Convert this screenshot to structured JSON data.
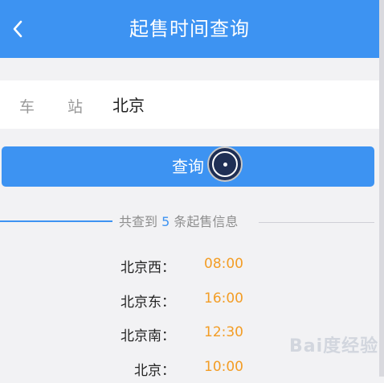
{
  "header": {
    "title": "起售时间查询",
    "back_icon": "chevron-left-icon",
    "color": "#3d93f2"
  },
  "form": {
    "station_label_chars": [
      "车",
      "站"
    ],
    "station_value": "北京"
  },
  "query_button": {
    "label": "查询"
  },
  "summary": {
    "prefix": "共查到",
    "count": "5",
    "suffix": "条起售信息"
  },
  "results": [
    {
      "station": "北京西：",
      "time": "08:00"
    },
    {
      "station": "北京东：",
      "time": "16:00"
    },
    {
      "station": "北京南：",
      "time": "12:30"
    },
    {
      "station": "北京：",
      "time": "10:00"
    }
  ],
  "colors": {
    "accent": "#3d93f2",
    "time": "#f39d25",
    "background": "#f2f2f4"
  },
  "watermark": {
    "text": "Bai度经验"
  }
}
